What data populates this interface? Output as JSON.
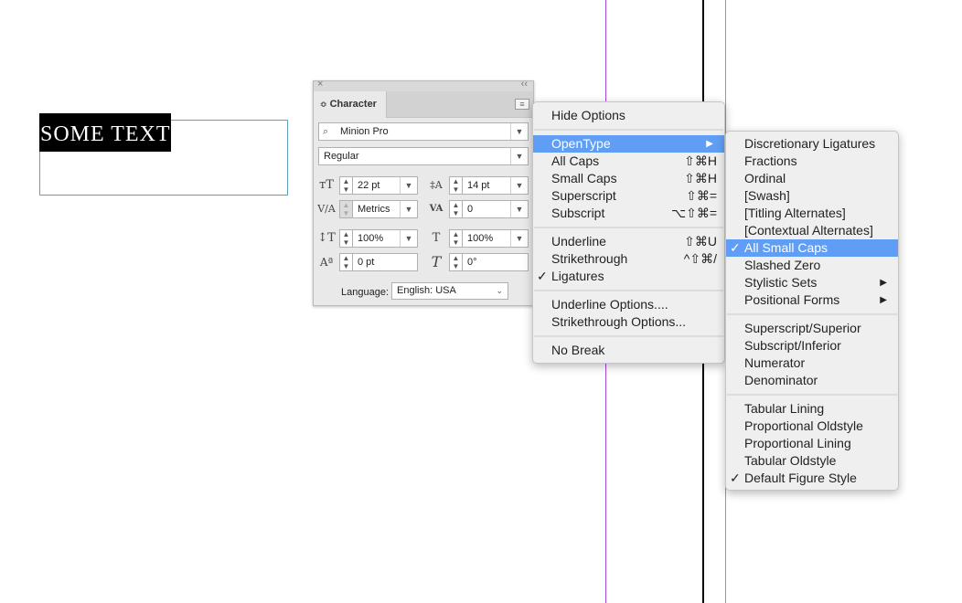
{
  "document": {
    "selected_text": "SOME TEXT"
  },
  "colors": {
    "guide_purple": "#a64ad8",
    "guide_black": "#000000",
    "guide_red": "#e0788a",
    "frame_border": "#5fa3ba",
    "menu_highlight": "#5f9ef4"
  },
  "panel": {
    "close_glyph": "×",
    "collapse_glyph": "‹‹",
    "tab_label": "Character",
    "tab_arrow": "≎",
    "menu_glyph": "≡",
    "font_family": "Minion Pro",
    "font_style": "Regular",
    "font_size": "22 pt",
    "leading": "14 pt",
    "kerning": "Metrics",
    "tracking": "0",
    "vertical_scale": "100%",
    "horizontal_scale": "100%",
    "baseline_shift": "0 pt",
    "skew": "0°",
    "language_label": "Language:",
    "language_value": "English: USA",
    "icons": [
      "font-size-icon",
      "leading-icon",
      "kerning-icon",
      "tracking-icon",
      "vertical-scale-icon",
      "horizontal-scale-icon",
      "baseline-shift-icon",
      "skew-icon"
    ]
  },
  "flyout_menu": {
    "items": [
      {
        "label": "Hide Options",
        "shortcut": "",
        "checked": false,
        "submenu": false
      },
      {
        "label": "OpenType",
        "shortcut": "",
        "checked": false,
        "submenu": true,
        "highlighted": true
      },
      {
        "label": "All Caps",
        "shortcut": "⇧⌘H",
        "checked": false
      },
      {
        "label": "Small Caps",
        "shortcut": "⇧⌘H",
        "checked": false
      },
      {
        "label": "Superscript",
        "shortcut": "⇧⌘=",
        "checked": false
      },
      {
        "label": "Subscript",
        "shortcut": "⌥⇧⌘=",
        "checked": false
      },
      {
        "label": "Underline",
        "shortcut": "⇧⌘U",
        "checked": false
      },
      {
        "label": "Strikethrough",
        "shortcut": "^⇧⌘/",
        "checked": false
      },
      {
        "label": "Ligatures",
        "shortcut": "",
        "checked": true
      },
      {
        "label": "Underline Options....",
        "shortcut": ""
      },
      {
        "label": "Strikethrough Options...",
        "shortcut": ""
      },
      {
        "label": "No Break",
        "shortcut": ""
      }
    ],
    "check_glyph": "✓",
    "submenu_glyph": "▶"
  },
  "opentype_menu": {
    "items": [
      {
        "label": "Discretionary Ligatures"
      },
      {
        "label": "Fractions"
      },
      {
        "label": "Ordinal"
      },
      {
        "label": "[Swash]"
      },
      {
        "label": "[Titling Alternates]"
      },
      {
        "label": "[Contextual Alternates]"
      },
      {
        "label": "All Small Caps",
        "checked": true,
        "highlighted": true
      },
      {
        "label": "Slashed Zero"
      },
      {
        "label": "Stylistic Sets",
        "submenu": true
      },
      {
        "label": "Positional Forms",
        "submenu": true
      },
      {
        "label": "Superscript/Superior"
      },
      {
        "label": "Subscript/Inferior"
      },
      {
        "label": "Numerator"
      },
      {
        "label": "Denominator"
      },
      {
        "label": "Tabular Lining"
      },
      {
        "label": "Proportional Oldstyle"
      },
      {
        "label": "Proportional Lining"
      },
      {
        "label": "Tabular Oldstyle"
      },
      {
        "label": "Default Figure Style",
        "checked": true
      }
    ]
  }
}
